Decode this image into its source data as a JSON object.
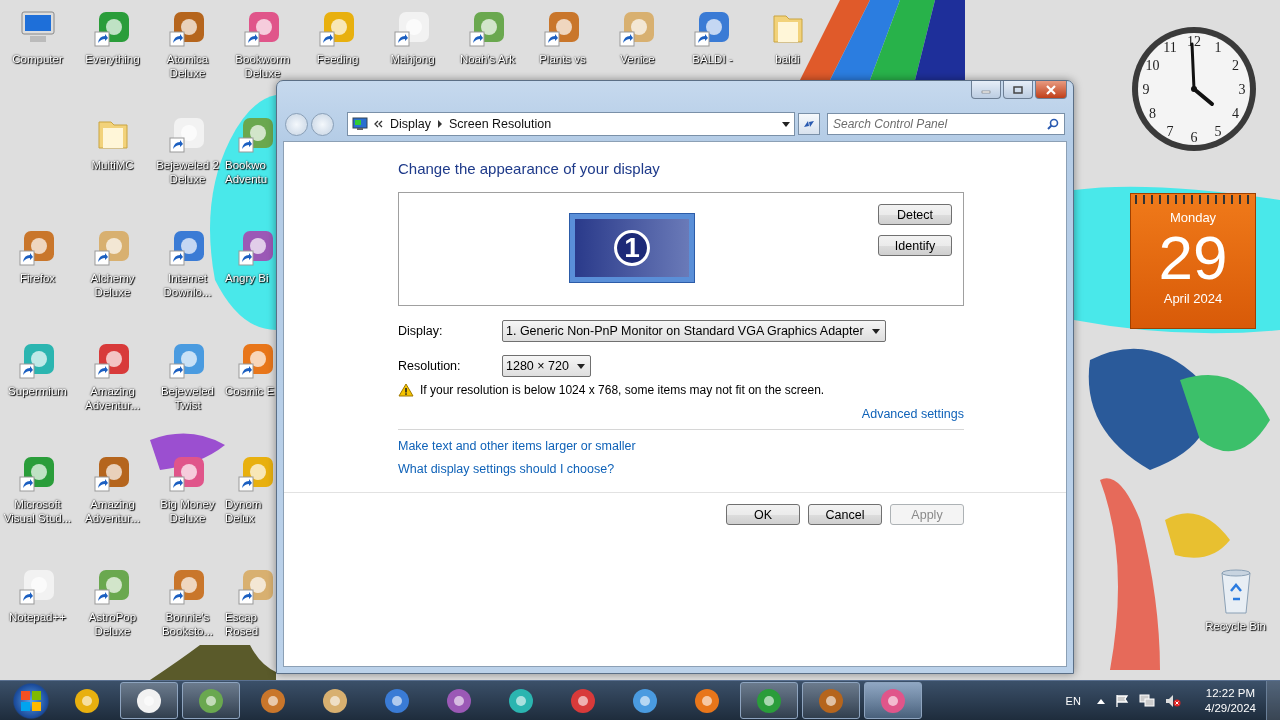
{
  "desktop": {
    "top_row": [
      {
        "label": "Computer",
        "kind": "computer",
        "shortcut": false
      },
      {
        "label": "Everything",
        "kind": "app",
        "shortcut": true
      },
      {
        "label": "Atomica Deluxe",
        "kind": "app",
        "shortcut": true
      },
      {
        "label": "Bookworm Deluxe",
        "kind": "app",
        "shortcut": true
      },
      {
        "label": "Feeding",
        "kind": "app",
        "shortcut": true
      },
      {
        "label": "Mahjong",
        "kind": "app",
        "shortcut": true
      },
      {
        "label": "Noah's Ark",
        "kind": "app",
        "shortcut": true
      },
      {
        "label": "Plants vs",
        "kind": "app",
        "shortcut": true
      },
      {
        "label": "Venice",
        "kind": "app",
        "shortcut": true
      },
      {
        "label": "BALDI -",
        "kind": "app",
        "shortcut": true
      },
      {
        "label": "baldi",
        "kind": "folder",
        "shortcut": false
      }
    ],
    "rows": [
      [
        {
          "kind": "empty"
        },
        {
          "label": "MultiMC",
          "kind": "folder",
          "shortcut": false
        },
        {
          "label": "Bejeweled 2 Deluxe",
          "kind": "app",
          "shortcut": true
        },
        {
          "label": "Bookwo\nAdventu",
          "kind": "app",
          "shortcut": true
        }
      ],
      [
        {
          "label": "Firefox",
          "kind": "app",
          "shortcut": true
        },
        {
          "label": "Alchemy Deluxe",
          "kind": "app",
          "shortcut": true
        },
        {
          "label": "Internet Downlo...",
          "kind": "app",
          "shortcut": true
        },
        {
          "label": "Angry Bi",
          "kind": "app",
          "shortcut": true
        }
      ],
      [
        {
          "label": "Supermium",
          "kind": "app",
          "shortcut": true
        },
        {
          "label": "Amazing Adventur...",
          "kind": "app",
          "shortcut": true
        },
        {
          "label": "Bejeweled Twist",
          "kind": "app",
          "shortcut": true
        },
        {
          "label": "Cosmic E",
          "kind": "app",
          "shortcut": true
        }
      ],
      [
        {
          "label": "Microsoft Visual Stud...",
          "kind": "app",
          "shortcut": true
        },
        {
          "label": "Amazing Adventur...",
          "kind": "app",
          "shortcut": true
        },
        {
          "label": "Big Money Deluxe",
          "kind": "app",
          "shortcut": true
        },
        {
          "label": "Dynom\nDelux",
          "kind": "app",
          "shortcut": true
        }
      ],
      [
        {
          "label": "Notepad++",
          "kind": "app",
          "shortcut": true
        },
        {
          "label": "AstroPop Deluxe",
          "kind": "app",
          "shortcut": true
        },
        {
          "label": "Bonnie's Booksto...",
          "kind": "app",
          "shortcut": true
        },
        {
          "label": "Escap\nRosed",
          "kind": "app",
          "shortcut": true
        }
      ]
    ]
  },
  "window": {
    "address": {
      "crumbs": [
        "Display",
        "Screen Resolution"
      ]
    },
    "search": {
      "placeholder": "Search Control Panel"
    },
    "heading": "Change the appearance of your display",
    "monitor": {
      "number": "1"
    },
    "monitor_buttons": [
      "Detect",
      "Identify"
    ],
    "fields": [
      {
        "label": "Display:",
        "value": "1. Generic Non-PnP Monitor on Standard VGA Graphics Adapter"
      },
      {
        "label": "Resolution:",
        "value": "1280 × 720"
      }
    ],
    "warning": "If your resolution is below 1024 x 768, some items may not fit on the screen.",
    "advanced_link": "Advanced settings",
    "links": [
      "Make text and other items larger or smaller",
      "What display settings should I choose?"
    ],
    "buttons": [
      {
        "label": "OK",
        "disabled": false
      },
      {
        "label": "Cancel",
        "disabled": false
      },
      {
        "label": "Apply",
        "disabled": true
      }
    ]
  },
  "gadgets": {
    "clock": {
      "numerals": [
        "12",
        "1",
        "2",
        "3",
        "4",
        "5",
        "6",
        "7",
        "8",
        "9",
        "10",
        "11"
      ]
    },
    "calendar": {
      "weekday": "Monday",
      "day": "29",
      "month_year": "April 2024"
    }
  },
  "recycle_bin": {
    "label": "Recycle Bin"
  },
  "taskbar": {
    "buttons": [
      {
        "open": false,
        "selected": false
      },
      {
        "open": true,
        "selected": false
      },
      {
        "open": true,
        "selected": false
      },
      {
        "open": false,
        "selected": false
      },
      {
        "open": false,
        "selected": false
      },
      {
        "open": false,
        "selected": false
      },
      {
        "open": false,
        "selected": false
      },
      {
        "open": false,
        "selected": false
      },
      {
        "open": false,
        "selected": false
      },
      {
        "open": false,
        "selected": false
      },
      {
        "open": false,
        "selected": false
      },
      {
        "open": true,
        "selected": false
      },
      {
        "open": true,
        "selected": false
      },
      {
        "open": true,
        "selected": true
      }
    ],
    "tray": {
      "language": "EN",
      "time": "12:22 PM",
      "date": "4/29/2024"
    }
  }
}
